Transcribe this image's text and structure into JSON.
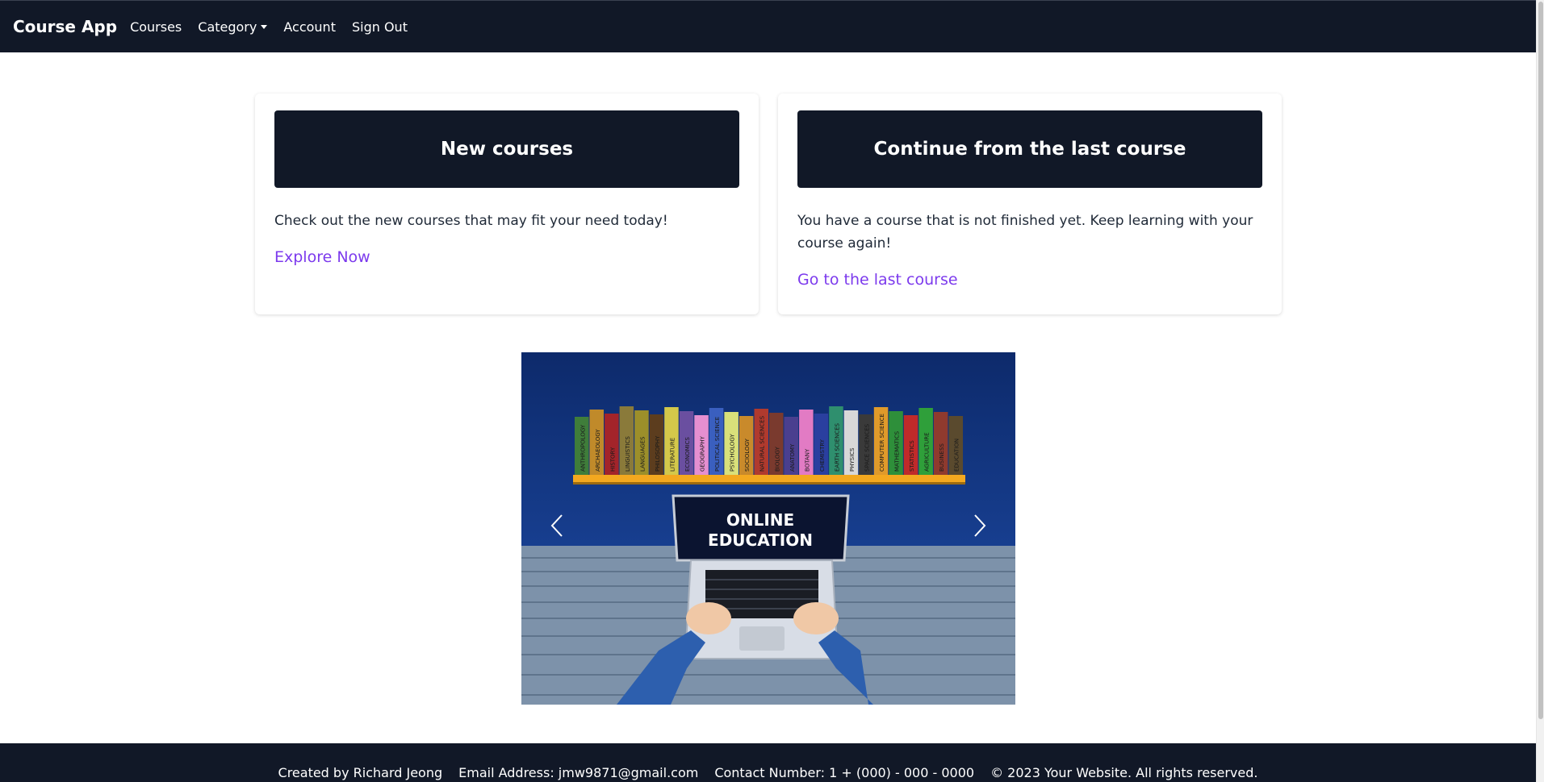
{
  "navbar": {
    "brand": "Course App",
    "links": [
      "Courses",
      "Category",
      "Account",
      "Sign Out"
    ]
  },
  "cards": [
    {
      "title": "New courses",
      "text": "Check out the new courses that may fit your need today!",
      "link": "Explore Now"
    },
    {
      "title": "Continue from the last course",
      "text": "You have a course that is not finished yet. Keep learning with your course again!",
      "link": "Go to the last course"
    }
  ],
  "carousel": {
    "image_text_line1": "ONLINE",
    "image_text_line2": "EDUCATION",
    "book_titles": [
      "ANTHROPOLOGY",
      "ARCHAEOLOGY",
      "HISTORY",
      "LINGUISTICS",
      "LANGUAGES",
      "PHILOSOPHY",
      "LITERATURE",
      "ECONOMICS",
      "GEOGRAPHY",
      "POLITICAL SCIENCE",
      "PSYCHOLOGY",
      "SOCIOLOGY",
      "NATURAL SCIENCES",
      "BIOLOGY",
      "ANATOMY",
      "BOTANY",
      "CHEMISTRY",
      "EARTH SCIENCES",
      "PHYSICS",
      "SPACE SCIENCES",
      "COMPUTER SCIENCE",
      "MATHEMATICS",
      "STATISTICS",
      "AGRICULTURE",
      "BUSINESS",
      "EDUCATION"
    ]
  },
  "footer": {
    "created_by": "Created by Richard Jeong",
    "email": "Email Address: jmw9871@gmail.com",
    "contact": "Contact Number: 1 + (000) - 000 - 0000",
    "copyright": "© 2023 Your Website. All rights reserved."
  },
  "colors": {
    "nav_bg": "#111827",
    "link_accent": "#7c3aed"
  }
}
